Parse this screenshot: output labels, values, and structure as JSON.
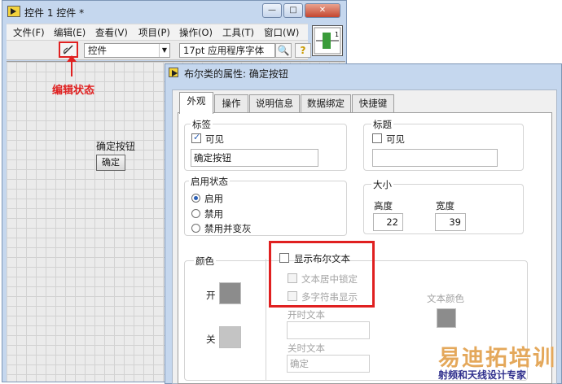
{
  "main_window": {
    "title": "控件 1 控件 *",
    "menu": [
      "文件(F)",
      "编辑(E)",
      "查看(V)",
      "项目(P)",
      "操作(O)",
      "工具(T)",
      "窗口(W)"
    ],
    "toolbar": {
      "control_select": "控件",
      "font_select": "17pt 应用程序字体"
    },
    "callout": "编辑状态",
    "front_panel": {
      "label": "确定按钮",
      "button_text": "确定"
    }
  },
  "dialog": {
    "title": "布尔类的属性: 确定按钮",
    "tabs": [
      "外观",
      "操作",
      "说明信息",
      "数据绑定",
      "快捷键"
    ],
    "label_group": {
      "title": "标签",
      "visible_label": "可见",
      "visible_checked": true,
      "value": "确定按钮"
    },
    "caption_group": {
      "title": "标题",
      "visible_label": "可见",
      "visible_checked": false,
      "value": ""
    },
    "enable_group": {
      "title": "启用状态",
      "options": [
        "启用",
        "禁用",
        "禁用并变灰"
      ],
      "selected": 0
    },
    "size_group": {
      "title": "大小",
      "height_label": "高度",
      "height_value": "22",
      "width_label": "宽度",
      "width_value": "39"
    },
    "colors_group": {
      "title": "颜色",
      "on_label": "开",
      "off_label": "关",
      "on_color": "#8c8c8c",
      "off_color": "#c4c4c4"
    },
    "boolean_text": {
      "show_label": "显示布尔文本",
      "lock_center_label": "文本居中锁定",
      "multi_string_label": "多字符串显示",
      "on_text_label": "开时文本",
      "on_text_value": "",
      "off_text_label": "关时文本",
      "off_text_value": "确定",
      "text_color_label": "文本颜色",
      "text_color": "#8c8c8c"
    }
  },
  "watermark": {
    "big": "易迪拓培训",
    "small": "射频和天线设计专家"
  },
  "colors": {
    "highlight": "#e02020",
    "title_bar": "#c5d7ee"
  }
}
